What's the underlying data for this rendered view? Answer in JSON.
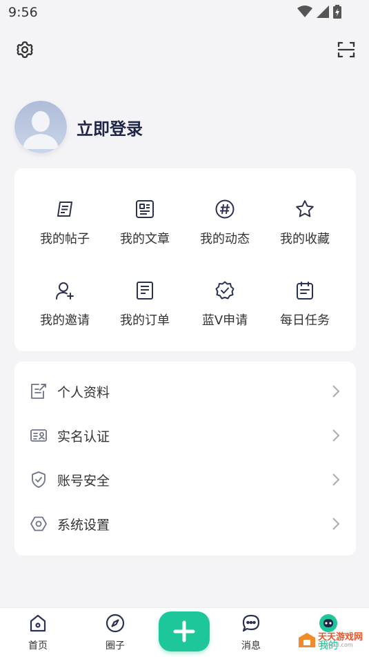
{
  "status_bar": {
    "time": "9:56"
  },
  "header": {
    "settings_icon": "gear-icon",
    "scan_icon": "scan-icon"
  },
  "profile": {
    "login_text": "立即登录",
    "avatar_icon": "default-avatar"
  },
  "quick_grid": {
    "items": [
      {
        "label": "我的帖子",
        "icon": "post-icon"
      },
      {
        "label": "我的文章",
        "icon": "article-icon"
      },
      {
        "label": "我的动态",
        "icon": "hashtag-icon"
      },
      {
        "label": "我的收藏",
        "icon": "star-icon"
      },
      {
        "label": "我的邀请",
        "icon": "invite-user-icon"
      },
      {
        "label": "我的订单",
        "icon": "order-icon"
      },
      {
        "label": "蓝V申请",
        "icon": "verified-badge-icon"
      },
      {
        "label": "每日任务",
        "icon": "calendar-icon"
      }
    ]
  },
  "settings_list": {
    "items": [
      {
        "label": "个人资料",
        "icon": "edit-profile-icon"
      },
      {
        "label": "实名认证",
        "icon": "id-card-icon"
      },
      {
        "label": "账号安全",
        "icon": "shield-icon"
      },
      {
        "label": "系统设置",
        "icon": "hexagon-settings-icon"
      }
    ]
  },
  "bottom_nav": {
    "items": [
      {
        "label": "首页",
        "icon": "home-icon"
      },
      {
        "label": "圈子",
        "icon": "compass-icon"
      },
      {
        "label": "消息",
        "icon": "chat-icon"
      },
      {
        "label": "我的",
        "icon": "profile-face-icon",
        "active": true
      }
    ],
    "fab_icon": "plus-icon"
  },
  "watermark": {
    "text": "天天游戏网",
    "sub": "ttdyx23.com"
  },
  "colors": {
    "accent": "#1ec79a",
    "title": "#1f2547",
    "background": "#f4f4f6",
    "icon_stroke": "#2a3050"
  }
}
